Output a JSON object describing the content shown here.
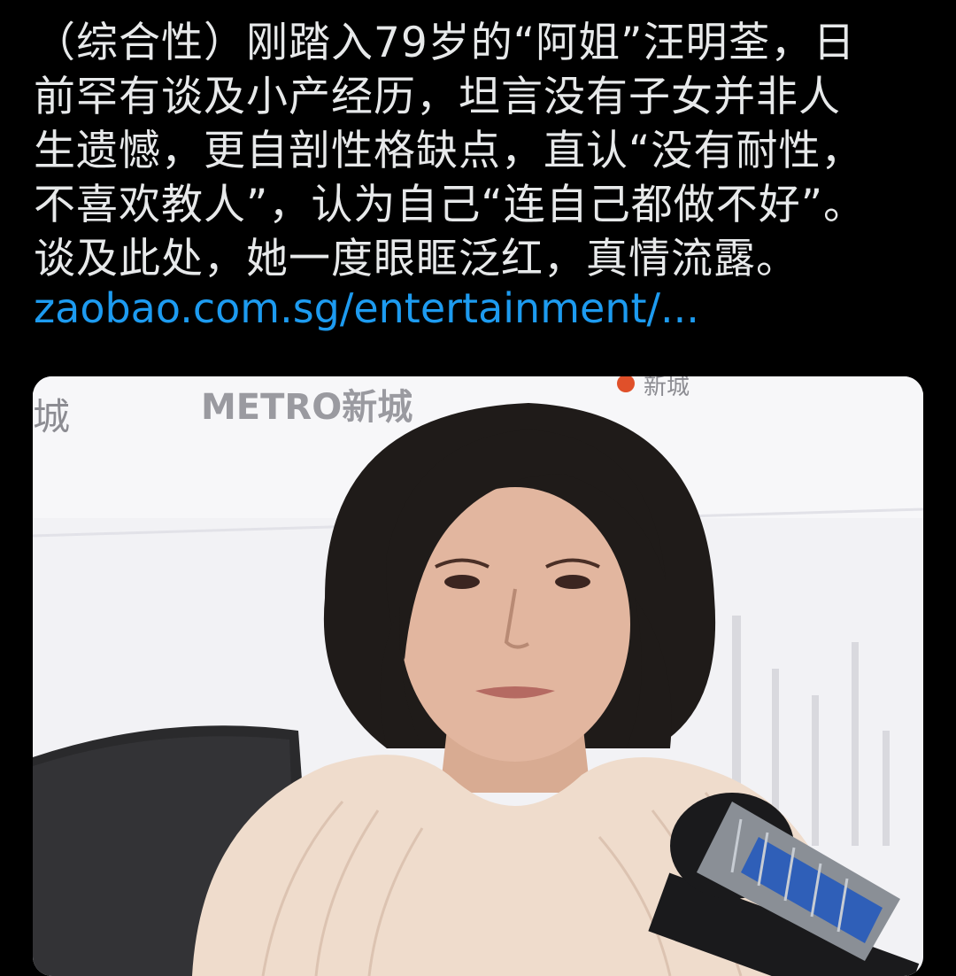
{
  "post": {
    "lines": [
      "（综合性）刚踏入79岁的“阿姐”汪明荃，日",
      "前罕有谈及小产经历，坦言没有子女并非人",
      "生遗憾，更自剖性格缺点，直认“没有耐性，",
      "不喜欢教人”，认为自己“连自己都做不好”。",
      "谈及此处，她一度眼眶泛红，真情流露。"
    ],
    "link": "zaobao.com.sg/entertainment/..."
  },
  "media": {
    "backdrop_logo": "METRO新城",
    "backdrop_side_text": "城",
    "backdrop_top_right": "新城"
  },
  "colors": {
    "background": "#000000",
    "text": "#e7e9ea",
    "link": "#1d9bf0"
  }
}
